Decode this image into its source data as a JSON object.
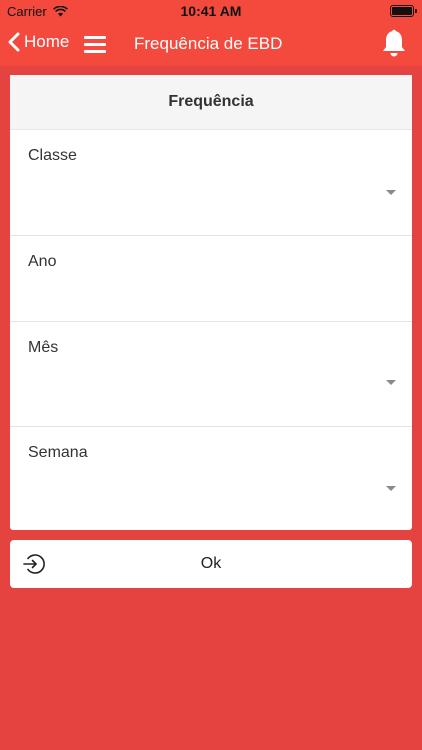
{
  "status_bar": {
    "carrier": "Carrier",
    "time": "10:41 AM"
  },
  "nav": {
    "back_label": "Home",
    "title": "Frequência de EBD",
    "icons": {
      "back": "chevron-left-icon",
      "menu": "hamburger-icon",
      "bell": "bell-icon"
    }
  },
  "form": {
    "header": "Frequência",
    "fields": [
      {
        "label": "Classe",
        "has_dropdown": true
      },
      {
        "label": "Ano",
        "has_dropdown": false
      },
      {
        "label": "Mês",
        "has_dropdown": true
      },
      {
        "label": "Semana",
        "has_dropdown": true
      }
    ]
  },
  "ok_button": {
    "label": "Ok",
    "icon": "sign-in-icon"
  },
  "colors": {
    "accent": "#f34a3d",
    "background": "#e44340",
    "card": "#ffffff"
  }
}
